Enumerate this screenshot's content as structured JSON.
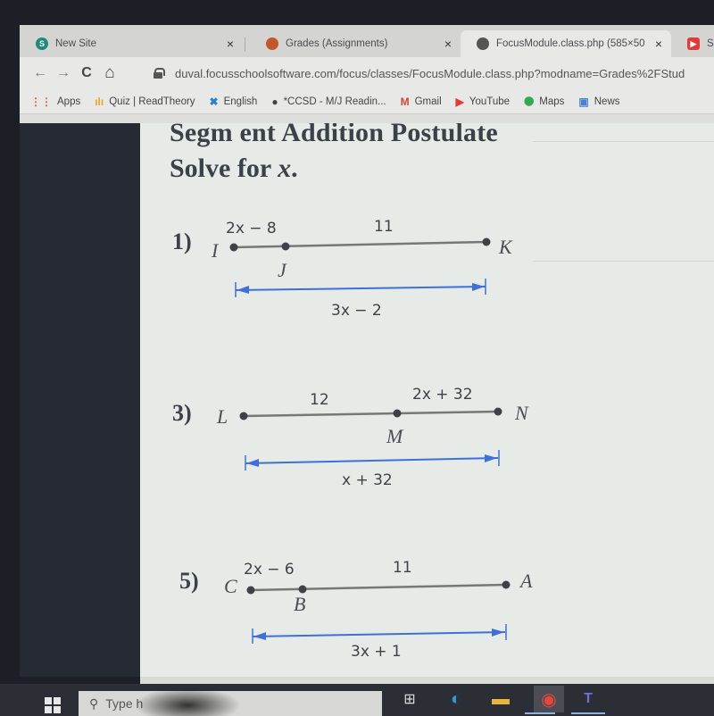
{
  "browser": {
    "tabs": [
      {
        "title": "New Site",
        "icon": "sharepoint-icon",
        "color": "#1b8a7a",
        "active": false
      },
      {
        "title": "Grades (Assignments)",
        "icon": "focus-avatar-icon",
        "color": "#c2572e",
        "active": false
      },
      {
        "title": "FocusModule.class.php (585×50",
        "icon": "globe-icon",
        "color": "#555555",
        "active": true
      },
      {
        "title": "Seg",
        "icon": "youtube-icon",
        "color": "#e53935",
        "active": false
      }
    ],
    "close_glyph": "×",
    "nav": {
      "back": "←",
      "forward": "→",
      "reload": "C",
      "home": "⌂"
    },
    "url": "duval.focusschoolsoftware.com/focus/classes/FocusModule.class.php?modname=Grades%2FStud",
    "bookmarks": [
      {
        "label": "Apps",
        "icon": "apps-grid-icon",
        "glyph": "⋮⋮",
        "color": "#e0663a"
      },
      {
        "label": "Quiz | ReadTheory",
        "icon": "bar-chart-icon",
        "glyph": "ılı",
        "color": "#e7a62a"
      },
      {
        "label": "English",
        "icon": "cross-x-icon",
        "glyph": "✖",
        "color": "#2a7fd4"
      },
      {
        "label": "*CCSD - M/J Readin...",
        "icon": "globe-icon",
        "glyph": "●",
        "color": "#444444"
      },
      {
        "label": "Gmail",
        "icon": "gmail-icon",
        "glyph": "M",
        "color": "#d44638"
      },
      {
        "label": "YouTube",
        "icon": "youtube-icon",
        "glyph": "▶",
        "color": "#e53935"
      },
      {
        "label": "Maps",
        "icon": "maps-pin-icon",
        "glyph": "⬤",
        "color": "#34a853"
      },
      {
        "label": "News",
        "icon": "news-icon",
        "glyph": "▣",
        "color": "#4a7fd8"
      }
    ]
  },
  "worksheet": {
    "title": "Segm ent Addition Postulate",
    "subtitle_prefix": "Solve for ",
    "subtitle_var": "x",
    "subtitle_suffix": ".",
    "accent_color": "#3f6fd8",
    "problems": [
      {
        "number": "1)",
        "points": [
          {
            "name": "I"
          },
          {
            "name": "J"
          },
          {
            "name": "K"
          }
        ],
        "segment_left": "2x − 8",
        "segment_right": "11",
        "total": "3x − 2"
      },
      {
        "number": "3)",
        "points": [
          {
            "name": "L"
          },
          {
            "name": "M"
          },
          {
            "name": "N"
          }
        ],
        "segment_left": "12",
        "segment_right": "2x + 32",
        "total": "x + 32"
      },
      {
        "number": "5)",
        "points": [
          {
            "name": "C"
          },
          {
            "name": "B"
          },
          {
            "name": "A"
          }
        ],
        "segment_left": "2x − 6",
        "segment_right": "11",
        "total": "3x + 1"
      }
    ]
  },
  "taskbar": {
    "search_placeholder": "Type h",
    "apps": [
      {
        "name": "task-view-icon",
        "glyph": "⊞"
      },
      {
        "name": "edge-icon",
        "glyph": "◐"
      },
      {
        "name": "file-explorer-icon",
        "glyph": "▬"
      },
      {
        "name": "chrome-icon",
        "glyph": "◉"
      },
      {
        "name": "teams-icon",
        "glyph": "T"
      }
    ]
  }
}
